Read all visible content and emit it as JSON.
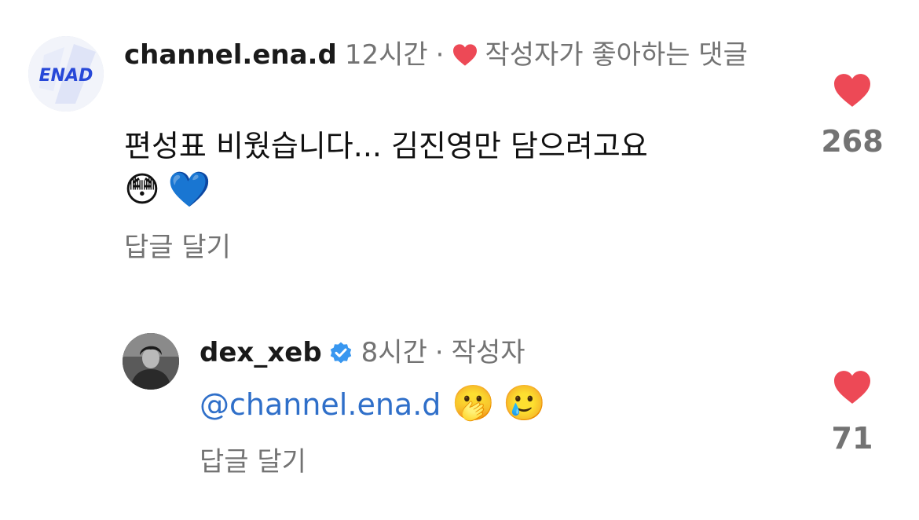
{
  "comments": [
    {
      "avatar_icon": "enad-logo-avatar",
      "avatar_text": "ENAD",
      "username": "channel.ena.d",
      "time": "12시간",
      "separator": "·",
      "liked_by_author_icon": "heart-icon",
      "liked_by_author_label": "작성자가 좋아하는 댓글",
      "text": "편성표 비웠습니다... 김진영만 담으려고요",
      "emojis": [
        "😳",
        "💙"
      ],
      "reply_label": "답글 달기",
      "like_icon": "heart-icon",
      "like_count": "268"
    },
    {
      "avatar_icon": "user-photo-avatar",
      "username": "dex_xeb",
      "verified_icon": "verified-badge-icon",
      "time": "8시간",
      "separator": "·",
      "author_label": "작성자",
      "mention": "@channel.ena.d",
      "emojis": [
        "🫢",
        "🥲"
      ],
      "reply_label": "답글 달기",
      "like_icon": "heart-icon",
      "like_count": "71"
    }
  ],
  "colors": {
    "heart": "#ed4956",
    "mention": "#2f6fc9",
    "verified": "#3897f0",
    "secondary_text": "#737373"
  }
}
